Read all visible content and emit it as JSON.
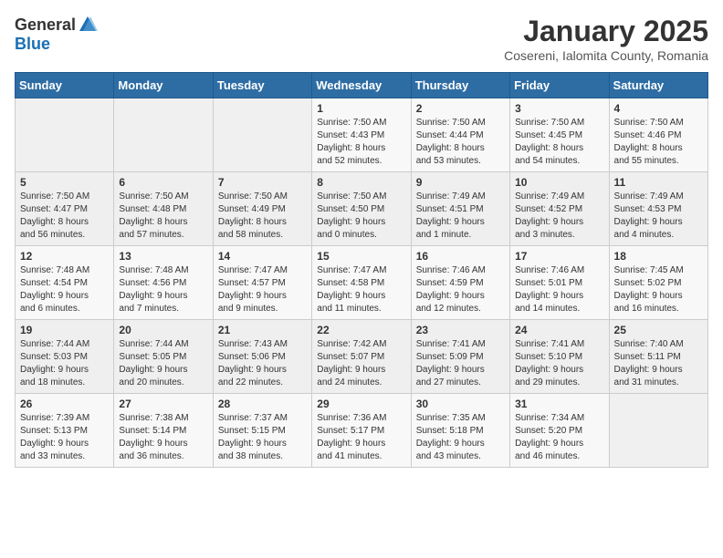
{
  "header": {
    "logo_general": "General",
    "logo_blue": "Blue",
    "title": "January 2025",
    "subtitle": "Cosereni, Ialomita County, Romania"
  },
  "columns": [
    "Sunday",
    "Monday",
    "Tuesday",
    "Wednesday",
    "Thursday",
    "Friday",
    "Saturday"
  ],
  "weeks": [
    [
      {
        "day": "",
        "info": ""
      },
      {
        "day": "",
        "info": ""
      },
      {
        "day": "",
        "info": ""
      },
      {
        "day": "1",
        "info": "Sunrise: 7:50 AM\nSunset: 4:43 PM\nDaylight: 8 hours\nand 52 minutes."
      },
      {
        "day": "2",
        "info": "Sunrise: 7:50 AM\nSunset: 4:44 PM\nDaylight: 8 hours\nand 53 minutes."
      },
      {
        "day": "3",
        "info": "Sunrise: 7:50 AM\nSunset: 4:45 PM\nDaylight: 8 hours\nand 54 minutes."
      },
      {
        "day": "4",
        "info": "Sunrise: 7:50 AM\nSunset: 4:46 PM\nDaylight: 8 hours\nand 55 minutes."
      }
    ],
    [
      {
        "day": "5",
        "info": "Sunrise: 7:50 AM\nSunset: 4:47 PM\nDaylight: 8 hours\nand 56 minutes."
      },
      {
        "day": "6",
        "info": "Sunrise: 7:50 AM\nSunset: 4:48 PM\nDaylight: 8 hours\nand 57 minutes."
      },
      {
        "day": "7",
        "info": "Sunrise: 7:50 AM\nSunset: 4:49 PM\nDaylight: 8 hours\nand 58 minutes."
      },
      {
        "day": "8",
        "info": "Sunrise: 7:50 AM\nSunset: 4:50 PM\nDaylight: 9 hours\nand 0 minutes."
      },
      {
        "day": "9",
        "info": "Sunrise: 7:49 AM\nSunset: 4:51 PM\nDaylight: 9 hours\nand 1 minute."
      },
      {
        "day": "10",
        "info": "Sunrise: 7:49 AM\nSunset: 4:52 PM\nDaylight: 9 hours\nand 3 minutes."
      },
      {
        "day": "11",
        "info": "Sunrise: 7:49 AM\nSunset: 4:53 PM\nDaylight: 9 hours\nand 4 minutes."
      }
    ],
    [
      {
        "day": "12",
        "info": "Sunrise: 7:48 AM\nSunset: 4:54 PM\nDaylight: 9 hours\nand 6 minutes."
      },
      {
        "day": "13",
        "info": "Sunrise: 7:48 AM\nSunset: 4:56 PM\nDaylight: 9 hours\nand 7 minutes."
      },
      {
        "day": "14",
        "info": "Sunrise: 7:47 AM\nSunset: 4:57 PM\nDaylight: 9 hours\nand 9 minutes."
      },
      {
        "day": "15",
        "info": "Sunrise: 7:47 AM\nSunset: 4:58 PM\nDaylight: 9 hours\nand 11 minutes."
      },
      {
        "day": "16",
        "info": "Sunrise: 7:46 AM\nSunset: 4:59 PM\nDaylight: 9 hours\nand 12 minutes."
      },
      {
        "day": "17",
        "info": "Sunrise: 7:46 AM\nSunset: 5:01 PM\nDaylight: 9 hours\nand 14 minutes."
      },
      {
        "day": "18",
        "info": "Sunrise: 7:45 AM\nSunset: 5:02 PM\nDaylight: 9 hours\nand 16 minutes."
      }
    ],
    [
      {
        "day": "19",
        "info": "Sunrise: 7:44 AM\nSunset: 5:03 PM\nDaylight: 9 hours\nand 18 minutes."
      },
      {
        "day": "20",
        "info": "Sunrise: 7:44 AM\nSunset: 5:05 PM\nDaylight: 9 hours\nand 20 minutes."
      },
      {
        "day": "21",
        "info": "Sunrise: 7:43 AM\nSunset: 5:06 PM\nDaylight: 9 hours\nand 22 minutes."
      },
      {
        "day": "22",
        "info": "Sunrise: 7:42 AM\nSunset: 5:07 PM\nDaylight: 9 hours\nand 24 minutes."
      },
      {
        "day": "23",
        "info": "Sunrise: 7:41 AM\nSunset: 5:09 PM\nDaylight: 9 hours\nand 27 minutes."
      },
      {
        "day": "24",
        "info": "Sunrise: 7:41 AM\nSunset: 5:10 PM\nDaylight: 9 hours\nand 29 minutes."
      },
      {
        "day": "25",
        "info": "Sunrise: 7:40 AM\nSunset: 5:11 PM\nDaylight: 9 hours\nand 31 minutes."
      }
    ],
    [
      {
        "day": "26",
        "info": "Sunrise: 7:39 AM\nSunset: 5:13 PM\nDaylight: 9 hours\nand 33 minutes."
      },
      {
        "day": "27",
        "info": "Sunrise: 7:38 AM\nSunset: 5:14 PM\nDaylight: 9 hours\nand 36 minutes."
      },
      {
        "day": "28",
        "info": "Sunrise: 7:37 AM\nSunset: 5:15 PM\nDaylight: 9 hours\nand 38 minutes."
      },
      {
        "day": "29",
        "info": "Sunrise: 7:36 AM\nSunset: 5:17 PM\nDaylight: 9 hours\nand 41 minutes."
      },
      {
        "day": "30",
        "info": "Sunrise: 7:35 AM\nSunset: 5:18 PM\nDaylight: 9 hours\nand 43 minutes."
      },
      {
        "day": "31",
        "info": "Sunrise: 7:34 AM\nSunset: 5:20 PM\nDaylight: 9 hours\nand 46 minutes."
      },
      {
        "day": "",
        "info": ""
      }
    ]
  ]
}
